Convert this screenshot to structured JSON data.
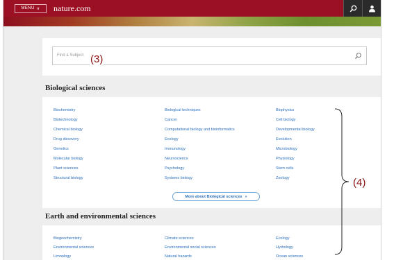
{
  "header": {
    "menu_label": "MENU",
    "menu_chevron": "chevron-down-icon",
    "site_name": "nature.com",
    "icons": [
      "search-icon",
      "user-icon"
    ],
    "bar_color": "#9b1022"
  },
  "search": {
    "placeholder": "Find a Subject",
    "icon": "search-icon",
    "callout": "(3)"
  },
  "biological": {
    "title": "Biological sciences",
    "columns": [
      [
        "Biochemistry",
        "Biotechnology",
        "Chemical biology",
        "Drug discovery",
        "Genetics",
        "Molecular biology",
        "Plant sciences",
        "Structural biology"
      ],
      [
        "Biological techniques",
        "Cancer",
        "Computational biology and bioinformatics",
        "Ecology",
        "Immunology",
        "Neuroscience",
        "Psychology",
        "Systems biology"
      ],
      [
        "Biophysics",
        "Cell biology",
        "Developmental biology",
        "Evolution",
        "Microbiology",
        "Physiology",
        "Stem cells",
        "Zoology"
      ]
    ],
    "more_label": "More about Biological sciences",
    "more_chevron": "»"
  },
  "earth": {
    "title": "Earth and environmental sciences",
    "columns": [
      [
        "Biogeochemistry",
        "Environmental sciences",
        "Limnology"
      ],
      [
        "Climate sciences",
        "Environmental social sciences",
        "Natural hazards"
      ],
      [
        "Ecology",
        "Hydrology",
        "Ocean sciences"
      ]
    ]
  },
  "annotation": {
    "callout": "(4)"
  },
  "colors": {
    "link": "#2a6ebd",
    "callout": "#8b1010",
    "background": "#eeeeee"
  }
}
